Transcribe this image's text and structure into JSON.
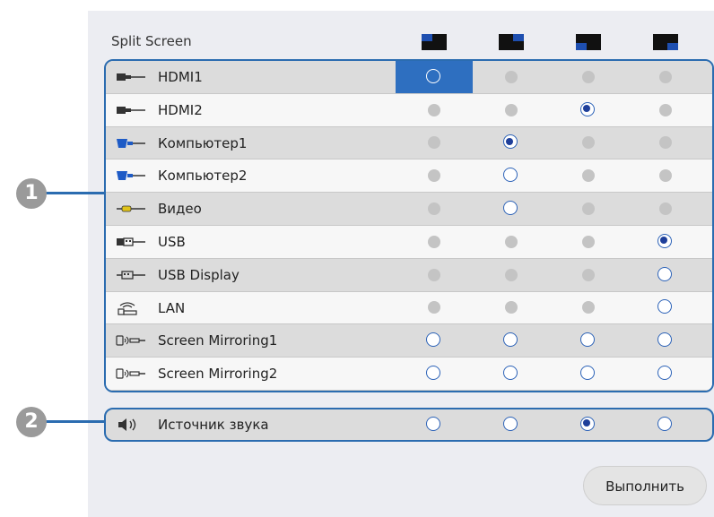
{
  "header": {
    "title": "Split Screen",
    "layouts": [
      "layout-top-left-icon",
      "layout-top-right-icon",
      "layout-bottom-left-icon",
      "layout-bottom-right-icon"
    ]
  },
  "sources": [
    {
      "label": "HDMI1",
      "icon": "hdmi-icon",
      "states": [
        "selected",
        "disabled",
        "disabled",
        "disabled"
      ]
    },
    {
      "label": "HDMI2",
      "icon": "hdmi-icon",
      "states": [
        "disabled",
        "disabled",
        "checked",
        "disabled"
      ]
    },
    {
      "label": "Компьютер1",
      "icon": "vga-computer-icon",
      "states": [
        "disabled",
        "checked",
        "disabled",
        "disabled"
      ]
    },
    {
      "label": "Компьютер2",
      "icon": "vga-computer-icon",
      "states": [
        "disabled",
        "empty",
        "disabled",
        "disabled"
      ]
    },
    {
      "label": "Видео",
      "icon": "video-rca-icon",
      "states": [
        "disabled",
        "empty",
        "disabled",
        "disabled"
      ]
    },
    {
      "label": "USB",
      "icon": "usb-icon",
      "states": [
        "disabled",
        "disabled",
        "disabled",
        "checked"
      ]
    },
    {
      "label": "USB Display",
      "icon": "usb-display-icon",
      "states": [
        "disabled",
        "disabled",
        "disabled",
        "empty"
      ]
    },
    {
      "label": "LAN",
      "icon": "lan-icon",
      "states": [
        "disabled",
        "disabled",
        "disabled",
        "empty"
      ]
    },
    {
      "label": "Screen Mirroring1",
      "icon": "screen-mirroring-icon",
      "states": [
        "empty",
        "empty",
        "empty",
        "empty"
      ]
    },
    {
      "label": "Screen Mirroring2",
      "icon": "screen-mirroring-icon",
      "states": [
        "empty",
        "empty",
        "empty",
        "empty"
      ]
    }
  ],
  "audio": {
    "label": "Источник звука",
    "icon": "speaker-icon",
    "states": [
      "empty",
      "empty",
      "checked",
      "empty"
    ]
  },
  "callouts": [
    "1",
    "2"
  ],
  "actions": {
    "run_label": "Выполнить"
  },
  "colors": {
    "accent": "#2b6cb0",
    "selected_cell": "#2e6fc0",
    "panel": "#ecedf2"
  }
}
